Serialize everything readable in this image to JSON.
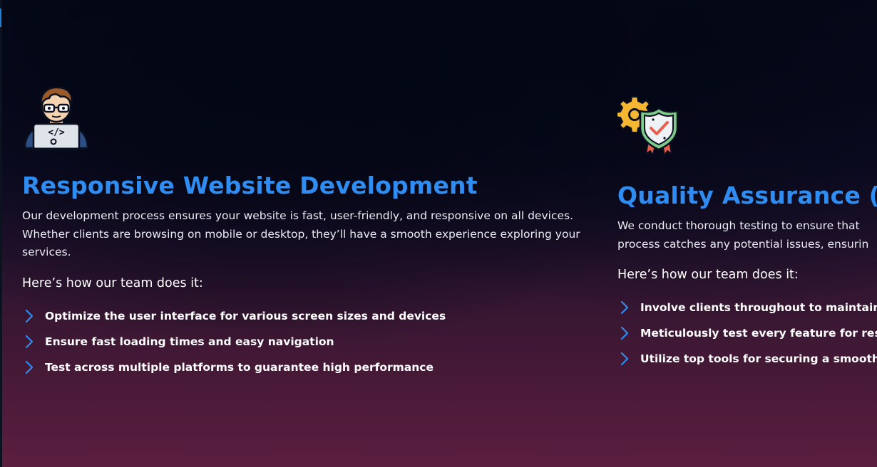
{
  "colors": {
    "accent": "#2f8cf0",
    "text": "#e9ecf3",
    "background_top": "#060a1c",
    "background_bottom": "#5c1e3f"
  },
  "services": [
    {
      "icon": "developer-icon",
      "title": "Responsive Website Development",
      "description": "Our development process ensures your website is fast, user-friendly, and responsive on all devices. Whether clients are browsing on mobile or desktop, they’ll have a smooth experience exploring your services.",
      "how_heading": "Here’s how our team does it:",
      "items": [
        "Optimize the user interface for various screen sizes and devices",
        "Ensure fast loading times and easy navigation",
        "Test across multiple platforms to guarantee high performance"
      ]
    },
    {
      "icon": "quality-shield-gear-icon",
      "title": "Quality Assurance (Q",
      "description_lines": [
        "We conduct thorough testing to ensure that",
        "process catches any potential issues, ensurin"
      ],
      "how_heading": "Here’s how our team does it:",
      "items": [
        "Involve clients throughout to maintain a",
        "Meticulously test every feature for respo",
        "Utilize top tools for securing a smooth w"
      ]
    }
  ]
}
